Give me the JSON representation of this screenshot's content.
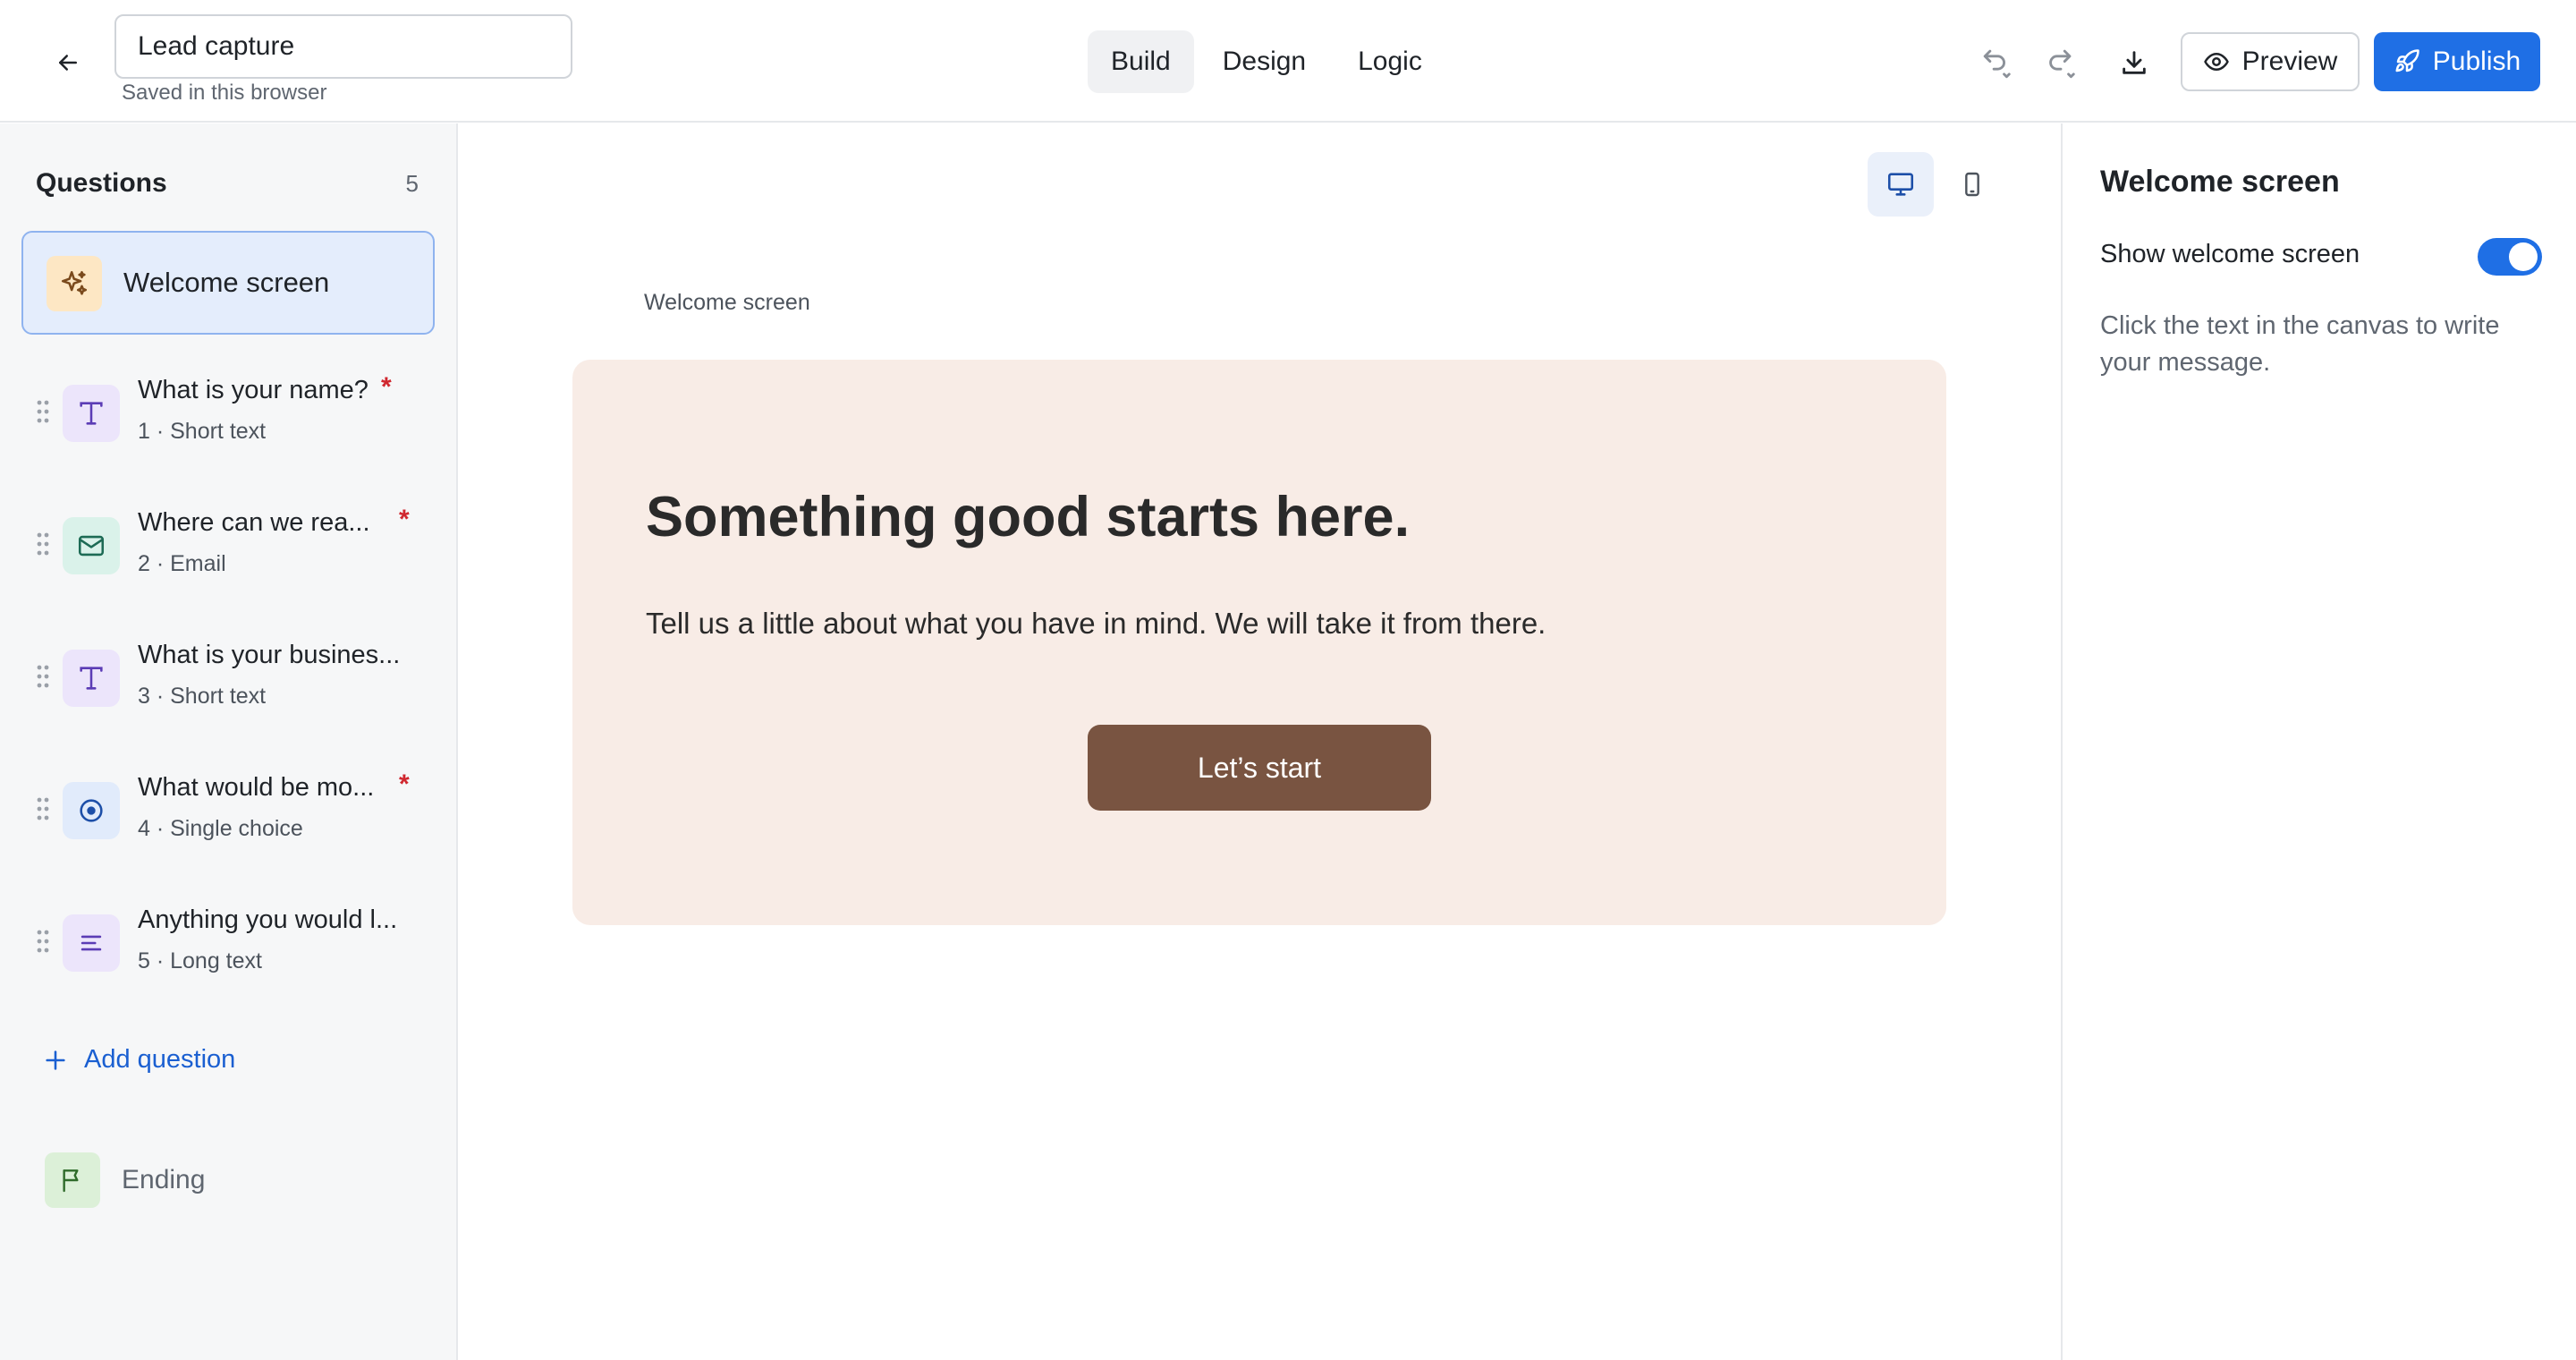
{
  "header": {
    "form_title": "Lead capture",
    "saved_status": "Saved in this browser",
    "tabs": [
      {
        "label": "Build",
        "active": true
      },
      {
        "label": "Design",
        "active": false
      },
      {
        "label": "Logic",
        "active": false
      }
    ],
    "preview_label": "Preview",
    "publish_label": "Publish"
  },
  "sidebar": {
    "title": "Questions",
    "count": "5",
    "welcome_label": "Welcome screen",
    "questions": [
      {
        "title": "What is your name?",
        "subtitle": "1 · Short text",
        "required": "*",
        "icon": "text-type-icon"
      },
      {
        "title": "Where can we rea...",
        "subtitle": "2 · Email",
        "required": "*",
        "icon": "mail-icon"
      },
      {
        "title": "What is your busines...",
        "subtitle": "3 · Short text",
        "required": "",
        "icon": "text-type-icon"
      },
      {
        "title": "What would be mo...",
        "subtitle": "4 · Single choice",
        "required": "*",
        "icon": "radio-icon"
      },
      {
        "title": "Anything you would l...",
        "subtitle": "5 · Long text",
        "required": "",
        "icon": "lines-icon"
      }
    ],
    "add_question_label": "Add question",
    "ending_label": "Ending"
  },
  "canvas": {
    "section_label": "Welcome screen",
    "heading": "Something good starts here.",
    "body": "Tell us a little about what you have in mind. We will take it from there.",
    "button_label": "Let’s start"
  },
  "panel": {
    "title": "Welcome screen",
    "toggle_label": "Show welcome screen",
    "toggle_on": true,
    "help_text": "Click the text in the canvas to write your message."
  },
  "colors": {
    "accent": "#1f6fe5",
    "card_bg": "#f8ece6",
    "card_button": "#795441",
    "required": "#d0272f"
  }
}
